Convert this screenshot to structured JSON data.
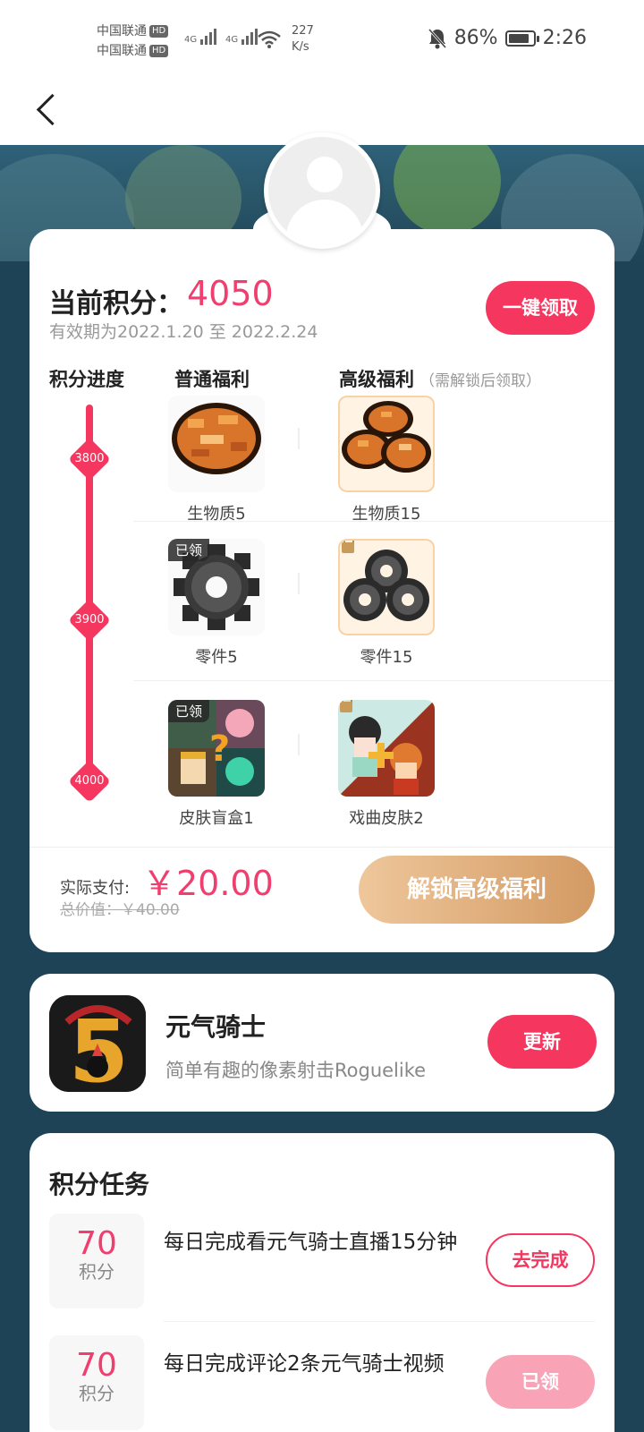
{
  "status_bar": {
    "carrier1": "中国联通",
    "carrier2": "中国联通",
    "hd": "HD",
    "net_type": "4G",
    "speed_value": "227",
    "speed_unit": "K/s",
    "battery": "86%",
    "battery_level": 0.86,
    "time": "2:26"
  },
  "points": {
    "label": "当前积分：",
    "value": "4050",
    "validity": "有效期为2022.1.20 至 2022.2.24",
    "claim_all": "一键领取",
    "col_progress": "积分进度",
    "col_basic": "普通福利",
    "col_premium": "高级福利",
    "col_premium_note": "（需解锁后领取）",
    "milestones": [
      "3800",
      "3900",
      "4000"
    ],
    "claimed_tag": "已领",
    "rows": [
      {
        "basic": "生物质5",
        "premium": "生物质15"
      },
      {
        "basic": "零件5",
        "premium": "零件15"
      },
      {
        "basic": "皮肤盲盒1",
        "premium": "戏曲皮肤2"
      }
    ]
  },
  "payment": {
    "paid_label": "实际支付:",
    "paid_value": "￥20.00",
    "total": "总价值：￥40.00",
    "unlock": "解锁高级福利"
  },
  "game": {
    "name": "元气骑士",
    "desc": "简单有趣的像素射击Roguelike",
    "update": "更新"
  },
  "tasks": {
    "title": "积分任务",
    "unit": "积分",
    "items": [
      {
        "points": "70",
        "desc": "每日完成看元气骑士直播15分钟",
        "action": "去完成"
      },
      {
        "points": "70",
        "desc": "每日完成评论2条元气骑士视频",
        "action": "已领"
      }
    ]
  },
  "colors": {
    "accent": "#f5365f",
    "gold_start": "#eec79b",
    "gold_end": "#d39a63",
    "background": "#1e4356"
  }
}
